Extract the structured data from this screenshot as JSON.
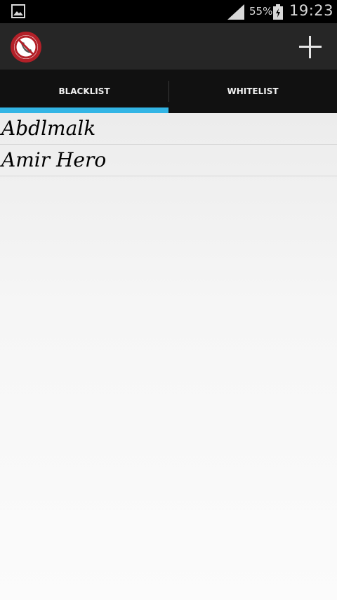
{
  "status_bar": {
    "notification_icon": "picture-icon",
    "signal_icon": "signal-icon",
    "battery_percent": "55%",
    "battery_icon": "battery-charging-icon",
    "time": "19:23"
  },
  "action_bar": {
    "app_icon": "blocked-phone-icon",
    "add_icon": "plus-icon"
  },
  "tabs": [
    {
      "label": "BLACKLIST",
      "selected": true
    },
    {
      "label": "WHITELIST",
      "selected": false
    }
  ],
  "list": {
    "items": [
      {
        "name": "Abdlmalk"
      },
      {
        "name": "Amir Hero"
      }
    ]
  },
  "colors": {
    "tab_indicator": "#33b5e5",
    "icon_red": "#b32028"
  }
}
